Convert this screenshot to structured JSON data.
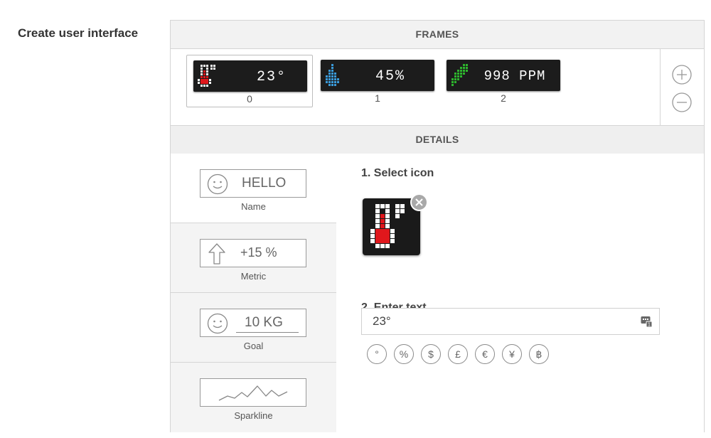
{
  "page": {
    "title": "Create user interface"
  },
  "frames": {
    "header": "FRAMES",
    "items": [
      {
        "index": "0",
        "icon": "thermometer-icon",
        "text": "23°",
        "selected": true
      },
      {
        "index": "1",
        "icon": "water-drop-icon",
        "text": "45%",
        "selected": false
      },
      {
        "index": "2",
        "icon": "leaf-icon",
        "text": "998 PPM",
        "selected": false
      }
    ],
    "controls": {
      "add_icon": "plus-circle-icon",
      "remove_icon": "minus-circle-icon"
    }
  },
  "details": {
    "header": "DETAILS",
    "types": [
      {
        "label": "Name",
        "preview_text": "HELLO",
        "icon": "smiley-icon"
      },
      {
        "label": "Metric",
        "preview_text": "+15 %",
        "icon": "arrow-up-icon"
      },
      {
        "label": "Goal",
        "preview_text": "10 KG",
        "icon": "smiley-icon"
      },
      {
        "label": "Sparkline",
        "preview_text": "",
        "icon": "sparkline-icon"
      }
    ],
    "select_icon_title": "1. Select icon",
    "selected_icon": "thermometer-icon",
    "enter_text_title": "2. Enter text",
    "text_value": "23°",
    "symbols": [
      "°",
      "%",
      "$",
      "£",
      "€",
      "¥",
      "฿"
    ]
  },
  "colors": {
    "thermometer_red": "#e0171c",
    "drop_blue": "#3a9ad9",
    "leaf_green": "#2db52d",
    "led_white": "#ffffff"
  }
}
